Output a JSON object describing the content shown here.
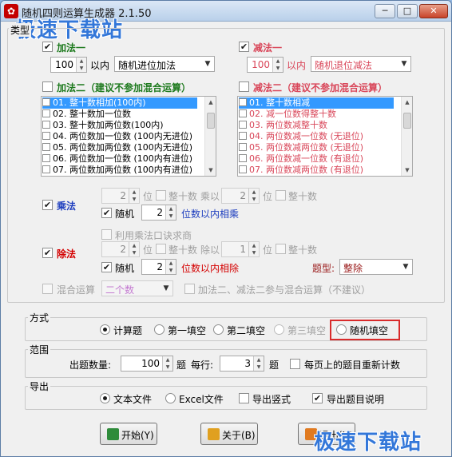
{
  "window": {
    "title": "随机四则运算生成器 2.1.50",
    "minimize": "─",
    "maximize": "□",
    "close": "✕"
  },
  "watermark": "极速下载站",
  "type_group": {
    "title": "类型"
  },
  "add1": {
    "label": "加法一",
    "checked": "✔",
    "limit": "100",
    "limit_unit": "以内",
    "mode": "随机进位加法"
  },
  "sub1": {
    "label": "减法一",
    "checked": "✔",
    "limit": "100",
    "limit_unit": "以内",
    "mode": "随机退位减法"
  },
  "add2": {
    "label": "加法二（建议不参加混合运算）",
    "items": [
      "01. 整十数相加(100内)",
      "02. 整十数加一位数",
      "03. 整十数加两位数(100内)",
      "04. 两位数加一位数  (100内无进位)",
      "05. 两位数加两位数  (100内无进位)",
      "06. 两位数加一位数  (100内有进位)",
      "07. 两位数加两位数  (100内有进位)"
    ]
  },
  "sub2": {
    "label": "减法二（建议不参加混合运算）",
    "items": [
      "01. 整十数相减",
      "02. 减一位数得整十数",
      "03. 两位数减整十数",
      "04. 两位数减一位数  (无退位)",
      "05. 两位数减两位数  (无退位)",
      "06. 两位数减一位数  (有退位)",
      "07. 两位数减两位数  (有退位)"
    ]
  },
  "mul": {
    "label": "乘法",
    "checked": "✔",
    "digits1": "2",
    "unit": "位",
    "whole_ten": "整十数",
    "times": "乘以",
    "digits2": "2",
    "random": "随机",
    "random_checked": "✔",
    "random_digits": "2",
    "random_suffix": "位数以内相乘"
  },
  "div": {
    "label": "除法",
    "checked": "✔",
    "use_table": "利用乘法口诀求商",
    "digits1": "2",
    "unit": "位",
    "whole_ten": "整十数",
    "divided_by": "除以",
    "digits2": "1",
    "random": "随机",
    "random_checked": "✔",
    "random_digits": "2",
    "random_suffix": "位数以内相除",
    "type_label": "题型:",
    "type_value": "整除"
  },
  "mixed": {
    "label": "混合运算",
    "value": "二个数",
    "note": "加法二、减法二参与混合运算（不建议）"
  },
  "mode_group": {
    "title": "方式",
    "options": [
      "计算题",
      "第一填空",
      "第二填空",
      "第三填空",
      "随机填空"
    ]
  },
  "range_group": {
    "title": "范围",
    "count_label": "出题数量:",
    "count": "100",
    "count_unit": "题",
    "per_row_label": "每行:",
    "per_row": "3",
    "per_row_unit": "题",
    "reshuffle": "每页上的题目重新计数"
  },
  "export_group": {
    "title": "导出",
    "text_file": "文本文件",
    "excel_file": "Excel文件",
    "vertical": "导出竖式",
    "export_desc": "导出题目说明",
    "export_desc_checked": "✔"
  },
  "buttons": {
    "start": "开始(Y)",
    "about": "关于(B)",
    "exit": "退出(X)"
  },
  "colors": {
    "accent_red": "#d40000",
    "highlight": "#d92b2b",
    "selection": "#3399ff"
  }
}
